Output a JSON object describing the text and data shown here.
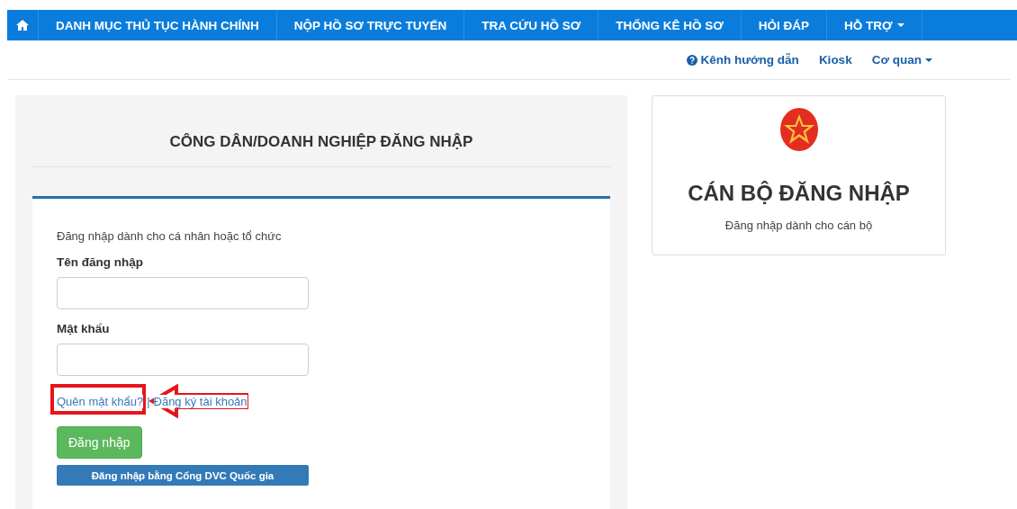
{
  "nav": {
    "items": [
      {
        "kind": "home"
      },
      {
        "kind": "text",
        "label": "DANH MỤC THỦ TỤC HÀNH CHÍNH"
      },
      {
        "kind": "text",
        "label": "NỘP HỒ SƠ TRỰC TUYẾN"
      },
      {
        "kind": "text",
        "label": "TRA CỨU HỒ SƠ"
      },
      {
        "kind": "text",
        "label": "THỐNG KÊ HỒ SƠ"
      },
      {
        "kind": "text",
        "label": "HỎI ĐÁP"
      },
      {
        "kind": "dropdown",
        "label": "HỖ TRỢ"
      }
    ]
  },
  "subnav": {
    "items": [
      {
        "kind": "help",
        "label": "Kênh hướng dẫn"
      },
      {
        "kind": "text",
        "label": "Kiosk"
      },
      {
        "kind": "dropdown",
        "label": "Cơ quan"
      }
    ]
  },
  "citizen_login": {
    "title": "CÔNG DÂN/DOANH NGHIỆP ĐĂNG NHẬP",
    "intro": "Đăng nhập dành cho cá nhân hoặc tổ chức",
    "fields": [
      {
        "label": "Tên đăng nhập"
      },
      {
        "label": "Mật khẩu"
      }
    ],
    "forgot_link": "Quên mật khẩu?",
    "separator": "|",
    "register_link": "Đăng ký tài khoản",
    "login_button": "Đăng nhập",
    "national_portal_button": "Đăng nhập bằng Cổng DVC Quốc gia"
  },
  "staff_login": {
    "title": "CÁN BỘ ĐĂNG NHẬP",
    "subtitle": "Đăng nhập dành cho cán bộ"
  }
}
